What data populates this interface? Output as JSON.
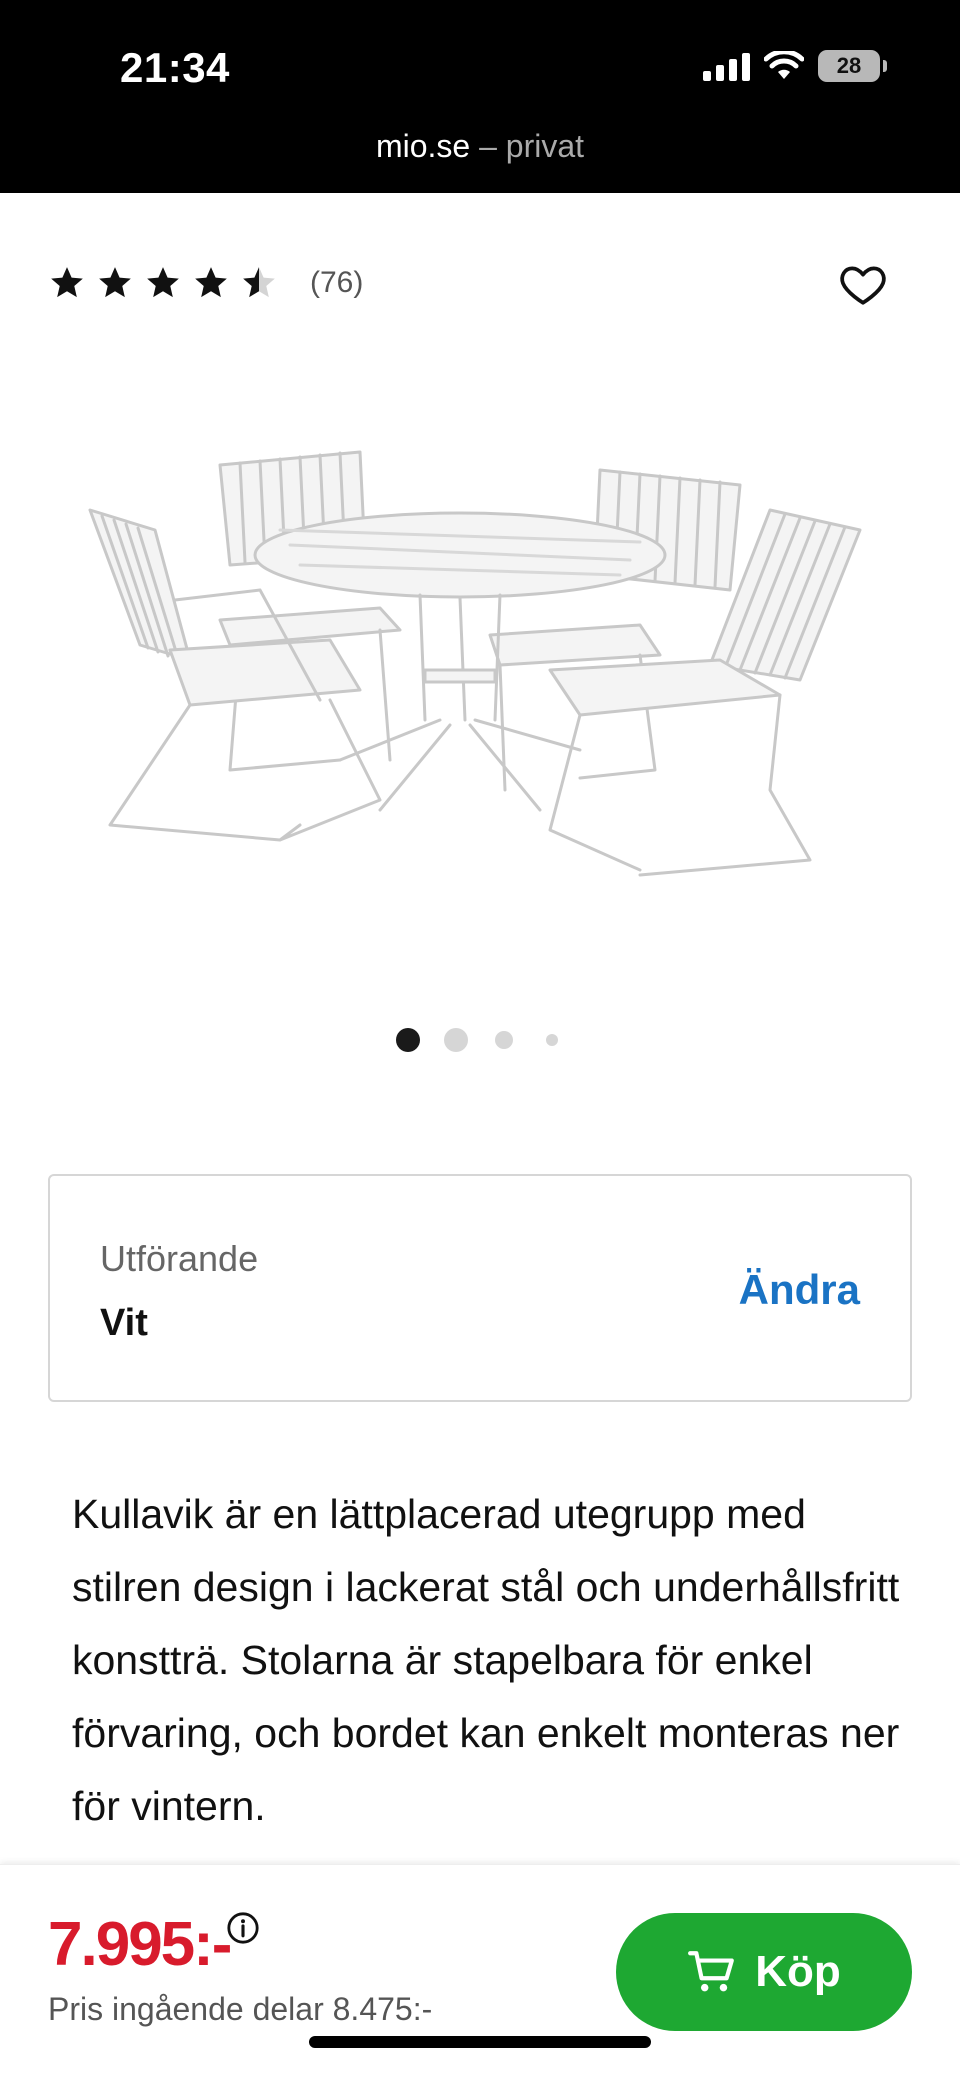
{
  "status_bar": {
    "time": "21:34",
    "battery": "28"
  },
  "browser": {
    "host": "mio.se",
    "separator": " – ",
    "context": "privat"
  },
  "rating": {
    "value": 4.5,
    "max": 5,
    "count": "(76)"
  },
  "gallery": {
    "image_alt": "Kullavik utegrupp vit",
    "active_index": 0,
    "total": 4
  },
  "variant": {
    "label": "Utförande",
    "value": "Vit",
    "change_label": "Ändra"
  },
  "description": "Kullavik är en lättplacerad utegrupp med stilren design i lackerat stål och underhållsfritt konstträ. Stolarna är stapelbara för enkel förvaring, och bordet kan enkelt monteras ner för vintern.",
  "purchase": {
    "price": "7.995:-",
    "price_note": "Pris ingående delar 8.475:-",
    "buy_label": "Köp"
  },
  "colors": {
    "price_red": "#d81b2c",
    "buy_green": "#1ea832",
    "link_blue": "#1a73c4"
  },
  "icons": [
    "star-icon",
    "heart-icon",
    "info-icon",
    "cart-icon",
    "wifi-icon",
    "signal-icon",
    "battery-icon"
  ]
}
